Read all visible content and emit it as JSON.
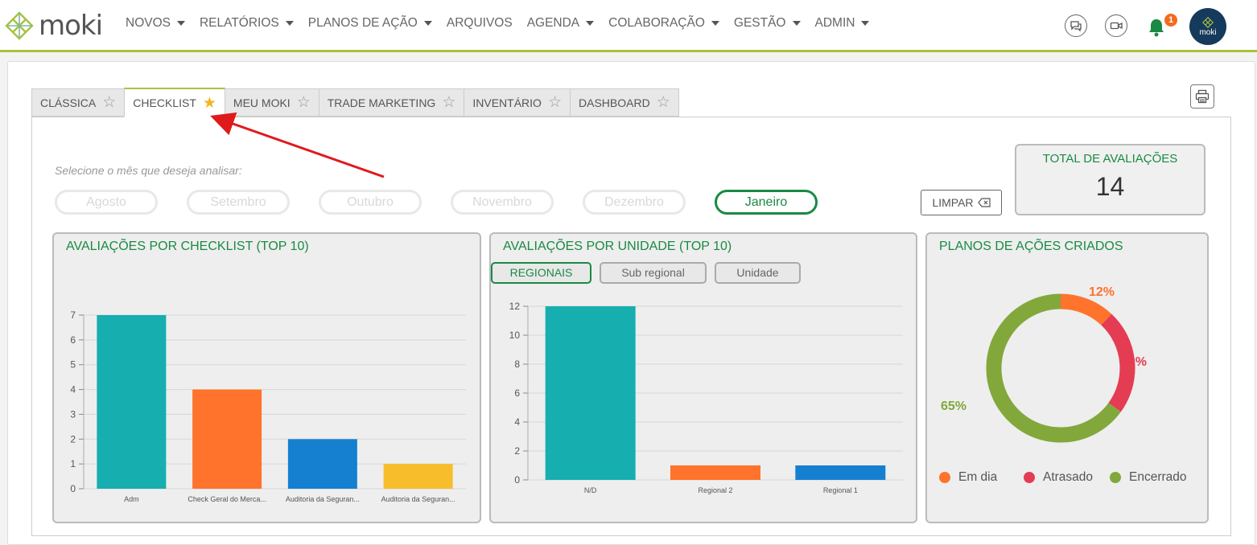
{
  "brand": {
    "name": "moki",
    "avatar_text": "moki"
  },
  "nav": [
    "NOVOS",
    "RELATÓRIOS",
    "PLANOS DE AÇÃO",
    "ARQUIVOS",
    "AGENDA",
    "COLABORAÇÃO",
    "GESTÃO",
    "ADMIN"
  ],
  "nav_has_caret": [
    true,
    true,
    true,
    false,
    true,
    true,
    true,
    true
  ],
  "notifications": {
    "count": "1"
  },
  "tabs": [
    {
      "label": "CLÁSSICA",
      "active": false
    },
    {
      "label": "CHECKLIST",
      "active": true
    },
    {
      "label": "MEU MOKI",
      "active": false
    },
    {
      "label": "TRADE MARKETING",
      "active": false
    },
    {
      "label": "INVENTÁRIO",
      "active": false
    },
    {
      "label": "DASHBOARD",
      "active": false
    }
  ],
  "month_prompt": "Selecione o mês que deseja analisar:",
  "months": [
    {
      "label": "Agosto",
      "selected": false
    },
    {
      "label": "Setembro",
      "selected": false
    },
    {
      "label": "Outubro",
      "selected": false
    },
    {
      "label": "Novembro",
      "selected": false
    },
    {
      "label": "Dezembro",
      "selected": false
    },
    {
      "label": "Janeiro",
      "selected": true
    }
  ],
  "clear_label": "LIMPAR",
  "total": {
    "label": "TOTAL DE AVALIAÇÕES",
    "value": "14"
  },
  "cards": {
    "checklist_title": "AVALIAÇÕES POR CHECKLIST (TOP 10)",
    "unidade_title": "AVALIAÇÕES POR UNIDADE  (TOP 10)",
    "planos_title": "PLANOS DE AÇÕES CRIADOS"
  },
  "unit_filters": [
    {
      "label": "REGIONAIS",
      "selected": true
    },
    {
      "label": "Sub regional",
      "selected": false
    },
    {
      "label": "Unidade",
      "selected": false
    }
  ],
  "colors": {
    "green": "#1a8a43",
    "accent": "#a9c23f",
    "teal": "#17aeb0",
    "orange": "#ff732c",
    "blue": "#1580d0",
    "yellow": "#f7bd2a",
    "red": "#e43c52",
    "olive": "#82a83c"
  },
  "chart_data": [
    {
      "type": "bar",
      "title": "AVALIAÇÕES POR CHECKLIST (TOP 10)",
      "categories": [
        "Adm",
        "Check Geral do Merca...",
        "Auditoria da Seguran...",
        "Auditoria da Seguran..."
      ],
      "values": [
        7,
        4,
        2,
        1
      ],
      "bar_colors": [
        "#17aeb0",
        "#ff732c",
        "#1580d0",
        "#f7bd2a"
      ],
      "ylim": [
        0,
        7
      ],
      "yticks": [
        "0",
        "1",
        "2",
        "3",
        "4",
        "5",
        "6",
        "7"
      ],
      "grid": true
    },
    {
      "type": "bar",
      "title": "AVALIAÇÕES POR UNIDADE  (TOP 10)",
      "categories": [
        "N/D",
        "Regional 2",
        "Regional 1"
      ],
      "values": [
        12,
        1,
        1
      ],
      "bar_colors": [
        "#17aeb0",
        "#ff732c",
        "#1580d0"
      ],
      "ylim": [
        0,
        12
      ],
      "yticks": [
        "0",
        "2",
        "4",
        "6",
        "8",
        "10",
        "12"
      ],
      "grid": true
    },
    {
      "type": "pie",
      "title": "PLANOS DE AÇÕES CRIADOS",
      "labels": [
        "Em dia",
        "Atrasado",
        "Encerrado"
      ],
      "values": [
        12,
        23,
        65
      ],
      "value_labels": [
        "12%",
        "23%",
        "65%"
      ],
      "colors": [
        "#ff732c",
        "#e43c52",
        "#82a83c"
      ],
      "legend": "bottom"
    }
  ]
}
